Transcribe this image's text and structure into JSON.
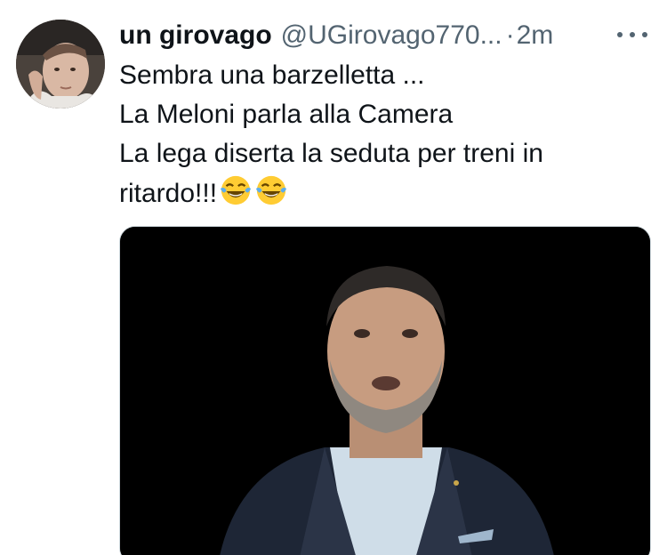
{
  "tweet": {
    "display_name": "un girovago",
    "handle": "@UGirovago770...",
    "separator": "·",
    "timestamp": "2m",
    "lines": [
      "Sembra una barzelletta ...",
      "La Meloni parla alla Camera",
      "La lega diserta la seduta per treni in",
      "ritardo!!!"
    ],
    "emojis": [
      "face-with-tears-of-joy-emoji",
      "face-with-tears-of-joy-emoji"
    ]
  },
  "colors": {
    "text_primary": "#0f1419",
    "text_secondary": "#536471",
    "media_border": "#cfd9de",
    "media_background": "#000000"
  },
  "icons": {
    "more": "more-horizontal-icon"
  }
}
